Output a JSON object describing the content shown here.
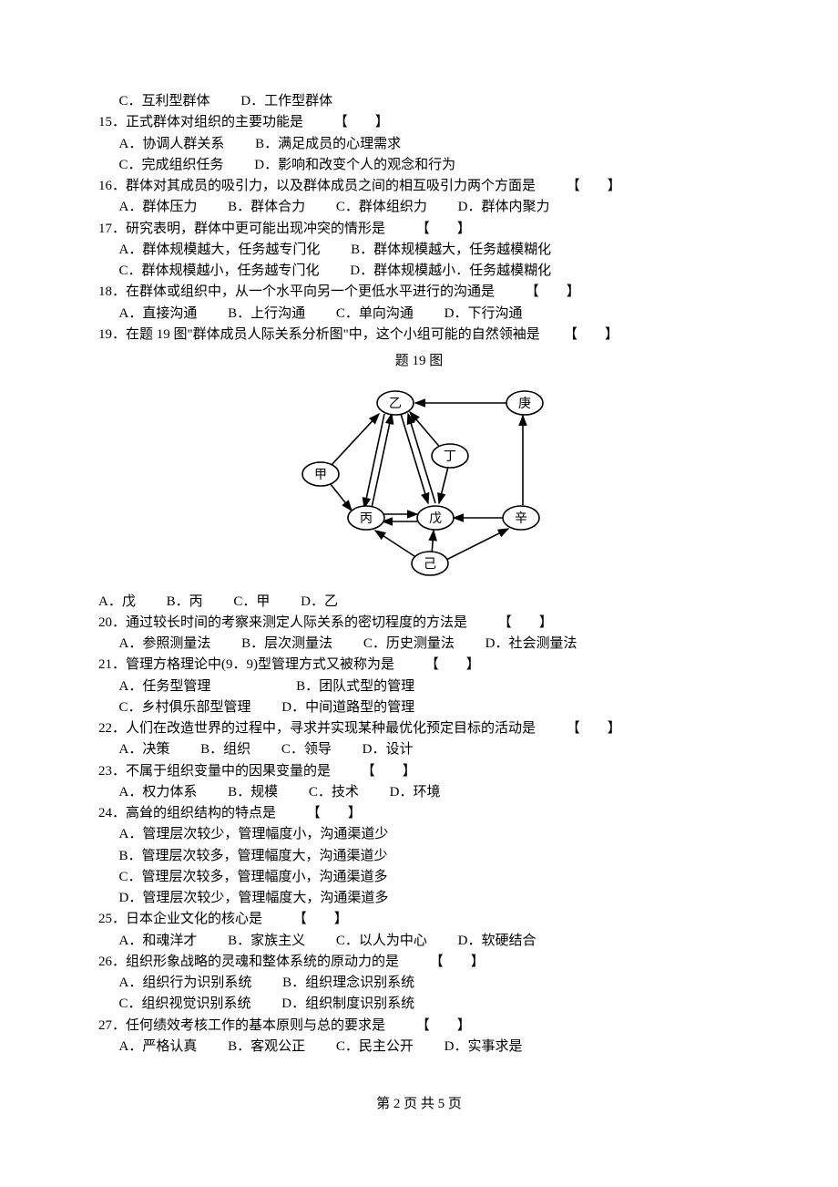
{
  "q14c": "C．互利型群体",
  "q14d": "D．工作型群体",
  "q15": "15．正式群体对组织的主要功能是",
  "q15a": "A．协调人群关系",
  "q15b": "B．满足成员的心理需求",
  "q15c": "C．完成组织任务",
  "q15d": "D．影响和改变个人的观念和行为",
  "q16": "16．群体对其成员的吸引力，以及群体成员之间的相互吸引力两个方面是",
  "q16a": "A．群体压力",
  "q16b": "B．群体合力",
  "q16c": "C．群体组织力",
  "q16d": "D．群体内聚力",
  "q17": "17．研究表明，群体中更可能出现冲突的情形是",
  "q17a": "A．群体规模越大，任务越专门化",
  "q17b": "B．群体规模越大，任务越模糊化",
  "q17c": "C．群体规模越小，任务越专门化",
  "q17d": "D．群体规模越小．任务越模糊化",
  "q18": "18．在群体或组织中，从一个水平向另一个更低水平进行的沟通是",
  "q18a": "A．直接沟通",
  "q18b": "B．上行沟通",
  "q18c": "C．单向沟通",
  "q18d": "D．下行沟通",
  "q19": "19．在题 19 图\"群体成员人际关系分析图\"中，这个小组可能的自然领袖是",
  "figcap": "题 19 图",
  "node_yi": "乙",
  "node_geng": "庚",
  "node_jia": "甲",
  "node_ding": "丁",
  "node_bing": "丙",
  "node_wu": "戊",
  "node_xin": "辛",
  "node_ji": "己",
  "q19a": "A．戊",
  "q19b": "B．丙",
  "q19c": "C．甲",
  "q19d": "D．乙",
  "q20": "20．通过较长时间的考察来测定人际关系的密切程度的方法是",
  "q20a": "A．参照测量法",
  "q20b": "B．层次测量法",
  "q20c": "C．历史测量法",
  "q20d": "D．社会测量法",
  "q21": "21．管理方格理论中(9．9)型管理方式又被称为是",
  "q21a": "A．任务型管理",
  "q21b": "B．团队式型的管理",
  "q21c": "C．乡村俱乐部型管理",
  "q21d": "D．中间道路型的管理",
  "q22": "22．人们在改造世界的过程中，寻求并实现某种最优化预定目标的活动是",
  "q22a": "A．决策",
  "q22b": "B．组织",
  "q22c": "C．领导",
  "q22d": "D．设计",
  "q23": "23．不属于组织变量中的因果变量的是",
  "q23a": "A．权力体系",
  "q23b": "B．规模",
  "q23c": "C．技术",
  "q23d": "D．环境",
  "q24": "24．高耸的组织结构的特点是",
  "q24a": "A．管理层次较少，管理幅度小，沟通渠道少",
  "q24b": "B．管理层次较多，管理幅度大，沟通渠道少",
  "q24c": "C．管理层次较多，管理幅度小，沟通渠道多",
  "q24d": "D．管理层次较少，管理幅度大，沟通渠道多",
  "q25": "25．日本企业文化的核心是",
  "q25a": "A．和魂洋才",
  "q25b": "B．家族主义",
  "q25c": "C．以人为中心",
  "q25d": "D．软硬结合",
  "q26": "26．组织形象战略的灵魂和整体系统的原动力的是",
  "q26a": "A．组织行为识别系统",
  "q26b": "B．组织理念识别系统",
  "q26c": "C．组织视觉识别系统",
  "q26d": "D．组织制度识别系统",
  "q27": "27．任何绩效考核工作的基本原则与总的要求是",
  "q27a": "A．严格认真",
  "q27b": "B．客观公正",
  "q27c": "C．民主公开",
  "q27d": "D．实事求是",
  "bracket_open": "【",
  "bracket_close": "】",
  "footer": "第 2 页 共 5 页"
}
